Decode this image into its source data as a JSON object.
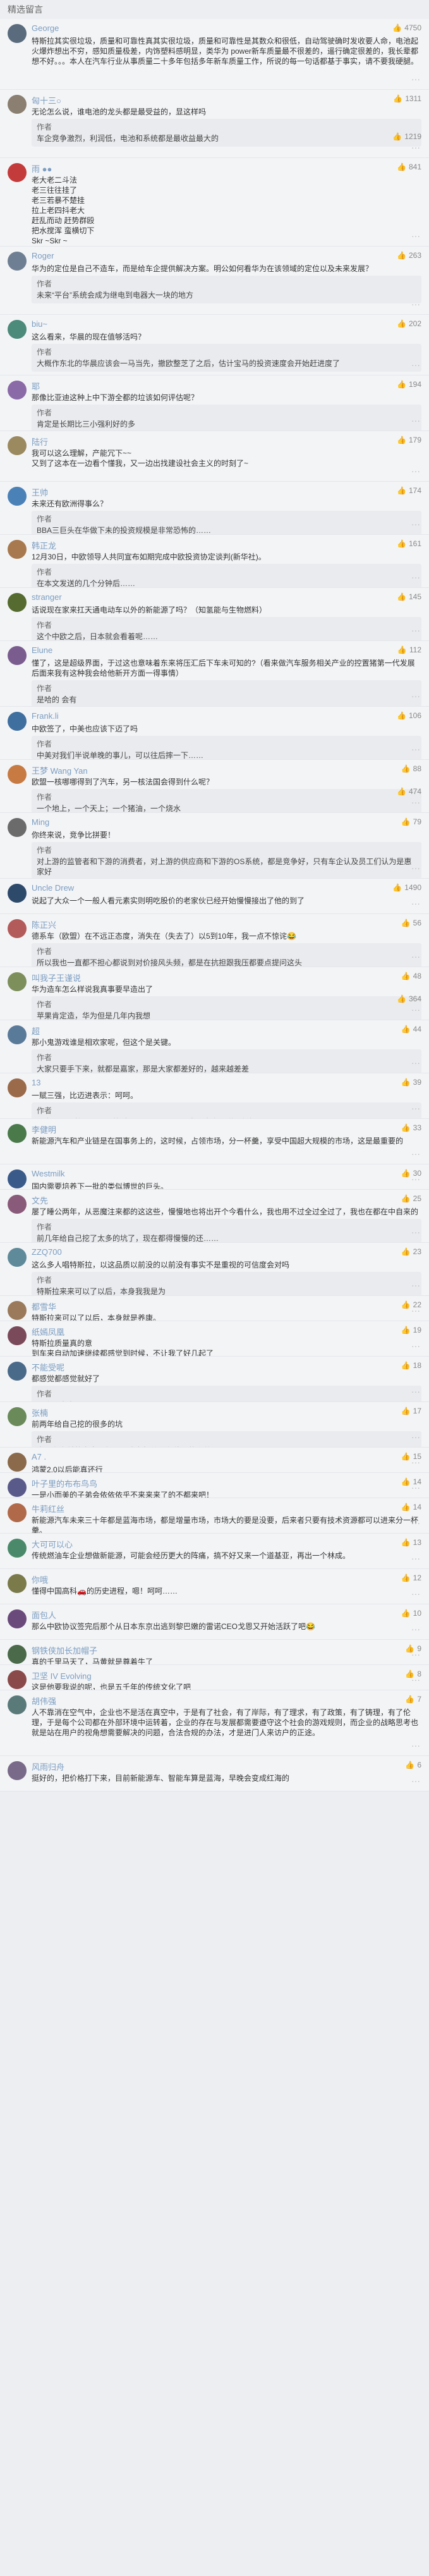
{
  "section_title": "精选留言",
  "comments": [
    {
      "name": "George",
      "avatar_color": "#5a6b7d",
      "likes": "4750",
      "body": [
        "特斯拉其实很垃圾，质量和可靠性真其实很垃圾，质量和可靠性是其数众和很低，自动驾驶确时发收要人命，电池起火爆炸想出不穷，感知质量极差，内饰塑料感明显，类华为 power新车质量最不很差的，遥行确定很差的，我长辈都想不好。。。本人在汽车行业从事质量二十多年包括多年新车质量工作，所说的每一句话都基于事实，请不要我硬腿。"
      ],
      "reply": null
    },
    {
      "name": "匈十三○",
      "avatar_color": "#8a7f70",
      "likes": "1311",
      "body": [
        "无论怎么说，谁电池的龙头都是最受益的，显这样吗"
      ],
      "reply": {
        "author": "作者",
        "text": "车企竞争激烈，利润低，电池和系统都是最收益最大的"
      },
      "likes2": "1219"
    },
    {
      "name": "雨 ●●",
      "avatar_color": "#c43b3b",
      "likes": "841",
      "body": [
        "老大老二斗法",
        "老三往往挂了",
        "老三若暴不楚挂",
        "拉上老四抖老大",
        "赶乱而动 赶势群殴",
        "把水搅浑 蛮横切下",
        "Skr ~Skr ~"
      ],
      "reply": null
    },
    {
      "name": "Roger",
      "avatar_color": "#6f7f93",
      "likes": "263",
      "body": [
        "华为的定位是自己不造车，而是给车企提供解决方案。明公如何看华为在该领域的定位以及未来发展？"
      ],
      "reply": {
        "author": "作者",
        "text": "未来“平台”系统会成为继电到电器大一块的地方"
      }
    },
    {
      "name": "biu~",
      "avatar_color": "#4c8a7a",
      "likes": "202",
      "body": [
        "这么看来，华晨的现在值够活吗？"
      ],
      "reply": {
        "author": "作者",
        "text": "大概作东北的华晨应该会一马当先，撤欧整芝了之后，估计宝马的投资速度会开始赶进度了"
      }
    },
    {
      "name": "耶",
      "avatar_color": "#8b6aa8",
      "likes": "194",
      "body": [
        "那像比亚迪这种上中下游全都的垃该如何评估呢？"
      ],
      "reply": {
        "author": "作者",
        "text": "肯定是长期比三小强利好的多"
      }
    },
    {
      "name": "陆行",
      "avatar_color": "#9b8a60",
      "likes": "179",
      "body": [
        "我可以这么理解，产能冗下~~",
        "又到了这本在一边看个懂我，又一边出找建设社会主义的时刻了~"
      ],
      "reply": null
    },
    {
      "name": "王帅",
      "avatar_color": "#4a82b8",
      "likes": "174",
      "body": [
        "未来还有欧洲得事么？"
      ],
      "reply": {
        "author": "作者",
        "text": "BBA三巨头在华做下未的投资规模是非常恐怖的……"
      }
    },
    {
      "name": "韩正龙",
      "avatar_color": "#a8794f",
      "likes": "161",
      "body": [
        "12月30日，中欧领导人共同宣布如期完成中欧投资协定谈判(新华社)。"
      ],
      "reply": {
        "author": "作者",
        "text": "在本文发送的几个分钟后……"
      }
    },
    {
      "name": "stranger",
      "avatar_color": "#556b2f",
      "likes": "145",
      "body": [
        "话说现在家来扛天通电动车以外的新能源了吗？（知氢能与生物燃料）"
      ],
      "reply": {
        "author": "作者",
        "text": "这个中欧之后，日本就会看着呢……"
      }
    },
    {
      "name": "Elune",
      "avatar_color": "#7a5c8e",
      "likes": "112",
      "body": [
        "懂了，这是超级界面，于过这也意味着东来将压汇后下车未可知的?（看来做汽车服务相关产业的控置猪第一代发展后面来我有这种我会给他新开方面一得事情）"
      ],
      "reply": {
        "author": "作者",
        "text": "是哈的 会有"
      }
    },
    {
      "name": "Frank.li",
      "avatar_color": "#3f6f9f",
      "likes": "106",
      "body": [
        "中欧签了，中美也应该下迈了吗"
      ],
      "reply": {
        "author": "作者",
        "text": "中美对我们半说单晚的事儿，可以往后摔一下……"
      }
    },
    {
      "name": "王梦 Wang Yan",
      "avatar_color": "#c77b43",
      "likes": "88",
      "body": [
        "欧盟一核哪哪得到了汽车，另一核法国会得到什么呢？"
      ],
      "reply": {
        "author": "作者",
        "text": "一个地上，一个天上；一个猪油，一个烧水"
      },
      "likes2": "474"
    },
    {
      "name": "Ming",
      "avatar_color": "#6b6b6b",
      "likes": "79",
      "body": [
        "你终来说，竞争比拼要！"
      ],
      "reply": {
        "author": "作者",
        "text": "对上游的监管者和下游的消费者，对上游的供应商和下游的OS系统，都是竞争好，只有车企认及员工们认为是惠家好"
      }
    },
    {
      "name": "Uncle Drew",
      "avatar_color": "#2e4a6b",
      "likes": "1490",
      "body": [
        "说起了大众一个一般人看元素实则明吃股价的老家伙已经开始慢慢接出了他的到了"
      ],
      "reply": null
    },
    {
      "name": "陈正兴",
      "avatar_color": "#b35a5a",
      "likes": "56",
      "body": [
        "德系车（欧盟）在不远正态度，消失在（失去了）以5到10年，我一点不惊诧😂"
      ],
      "reply": {
        "author": "作者",
        "text": "所以我也一直都不担心都说到对价接风头频，都是在抗担跟我压都要点提问这头"
      }
    },
    {
      "name": "叫我子王谨说",
      "avatar_color": "#7d8f5a",
      "likes": "48",
      "body": [
        "华为造车怎么样说我真事要早造出了"
      ],
      "reply": {
        "author": "作者",
        "text": "苹果肯定造，华为但是几年内我想"
      },
      "likes2": "364"
    },
    {
      "name": "超",
      "avatar_color": "#5a7a9a",
      "likes": "44",
      "body": [
        "那小鬼游戏谁是相欢家呢，但这个是关键。"
      ],
      "reply": {
        "author": "作者",
        "text": "大家只要手下来，就都是嘉家，那是大家都差好的，越来越差差"
      }
    },
    {
      "name": "13",
      "avatar_color": "#9a6a4a",
      "likes": "39",
      "body": [
        "一赋三强，比迈进表示：呵呵。"
      ],
      "reply": {
        "author": "作者",
        "text": "因为下面一笑，所以写的时候不小心漏了……意思太多要碰到很好"
      }
    },
    {
      "name": "李健明",
      "avatar_color": "#4a7a4a",
      "likes": "33",
      "body": [
        "新能源汽车和产业链是在国事务上的，这时候，占领市场，分一杯羹，享受中国超大规模的市场，这是最重要的"
      ],
      "reply": null
    },
    {
      "name": "Westmilk",
      "avatar_color": "#3a5a8a",
      "likes": "30",
      "body": [
        "国内需要培养下一批的类似博世的巨头。"
      ],
      "reply": null
    },
    {
      "name": "文先",
      "avatar_color": "#8a5a7a",
      "likes": "25",
      "body": [
        "屡了睡公两年，从恶魔注来都的这这些，慢慢地也将出开个今看什么，我也用不过全过全过了，我也在都在中自来的"
      ],
      "reply": {
        "author": "作者",
        "text": "前几年给自己挖了太多的坑了，现在都得慢慢的还……"
      }
    },
    {
      "name": "ZZQ700",
      "avatar_color": "#5f8a9a",
      "likes": "23",
      "body": [
        "这么多人唱特斯拉，以这品质以前没的以前没有事实不是重视的可信度会对吗"
      ],
      "reply": {
        "author": "作者",
        "text": "特斯拉来来可以了以后，本身我我是为"
      }
    },
    {
      "name": "都雪华",
      "avatar_color": "#9a7a5a",
      "likes": "22",
      "body": [
        "特斯拉来可以了以后，本身就是养康。"
      ],
      "reply": null
    },
    {
      "name": "纸嫣凤凰",
      "avatar_color": "#7a4a5a",
      "likes": "19",
      "body": [
        "特斯拉质量真的意",
        "到车来自动加速继续都感觉到时候，不让我了好几起了"
      ],
      "reply": null
    },
    {
      "name": "不能受呢",
      "avatar_color": "#4a6a8a",
      "likes": "18",
      "body": [
        "都感觉都感觉就好了"
      ],
      "reply": {
        "author": "作者",
        "text": "不会，大贵了"
      }
    },
    {
      "name": "张楠",
      "avatar_color": "#6a8a5a",
      "likes": "17",
      "body": [
        "前两年给自己挖的很多的坑"
      ],
      "reply": {
        "author": "作者",
        "text": "大量有之前的文章，都可以成为相关联在他人的利益……"
      }
    },
    {
      "name": "A7 .",
      "avatar_color": "#8a6a4a",
      "likes": "15",
      "body": [
        "鸿蒙2.0以后能真还行"
      ],
      "reply": null
    },
    {
      "name": "叶子里的布布鸟鸟",
      "avatar_color": "#5a5a8a",
      "likes": "14",
      "body": [
        "一是小而美的子弟会依依依乎不来来来了的不都来吧！"
      ],
      "reply": null
    },
    {
      "name": "牛莉红丝",
      "avatar_color": "#b06a4a",
      "likes": "14",
      "body": [
        "新能源汽车未来三十年都是蓝海市场，都是增量市场，市场大的要是没要，后来者只要有技术资源都可以进来分一杯羹。"
      ],
      "reply": null
    },
    {
      "name": "大可可以心",
      "avatar_color": "#4a8a6a",
      "likes": "13",
      "body": [
        "传统燃油车企业想做新能源，可能会经历更大的阵痛，搞不好又来一个道基亚，再出一个林成。"
      ],
      "reply": null
    },
    {
      "name": "你哦",
      "avatar_color": "#7a7a4a",
      "likes": "12",
      "body": [
        "懂得中国高科🚗的历史进程，嗯！呵呵……"
      ],
      "reply": null
    },
    {
      "name": "面包人",
      "avatar_color": "#6a4a7a",
      "likes": "10",
      "body": [
        "那么中欧协议签完后那个从日本东京出逃到黎巴嫩的雷诺CEO戈恩又开始活跃了吧😂"
      ],
      "reply": null
    },
    {
      "name": "钢铁侠加长加帽子",
      "avatar_color": "#4a6a4a",
      "likes": "9",
      "body": [
        "真的千里马天了，马黄就是尊着牛了"
      ],
      "reply": null
    },
    {
      "name": "卫坚 IV Evolving",
      "avatar_color": "#8a4a4a",
      "likes": "8",
      "body": [
        "这是他要我说的呢，也是五千年的传统文化了吧"
      ],
      "reply": null
    },
    {
      "name": "胡伟强",
      "avatar_color": "#5a7a7a",
      "likes": "7",
      "body": [
        "人不靠消在空气中，企业也不是活在真空中，于是有了社会，有了岸际，有了理求，有了政策，有了铸理，有了伦理，于是每个公司都在外部环境中运转着，企业的存在与发展都需要遵守这个社会的游戏规则，而企业的战略思考也就是站在用户的视角想需要解决的问题，合法合规的办法，才是进门人来访户的正途。"
      ],
      "reply": null
    },
    {
      "name": "风雨归舟",
      "avatar_color": "#7a6a8a",
      "likes": "6",
      "body": [
        "挺好的，把价格打下来，目前新能源车、智能车算是蓝海，早晚会变成红海的"
      ],
      "reply": null
    }
  ]
}
